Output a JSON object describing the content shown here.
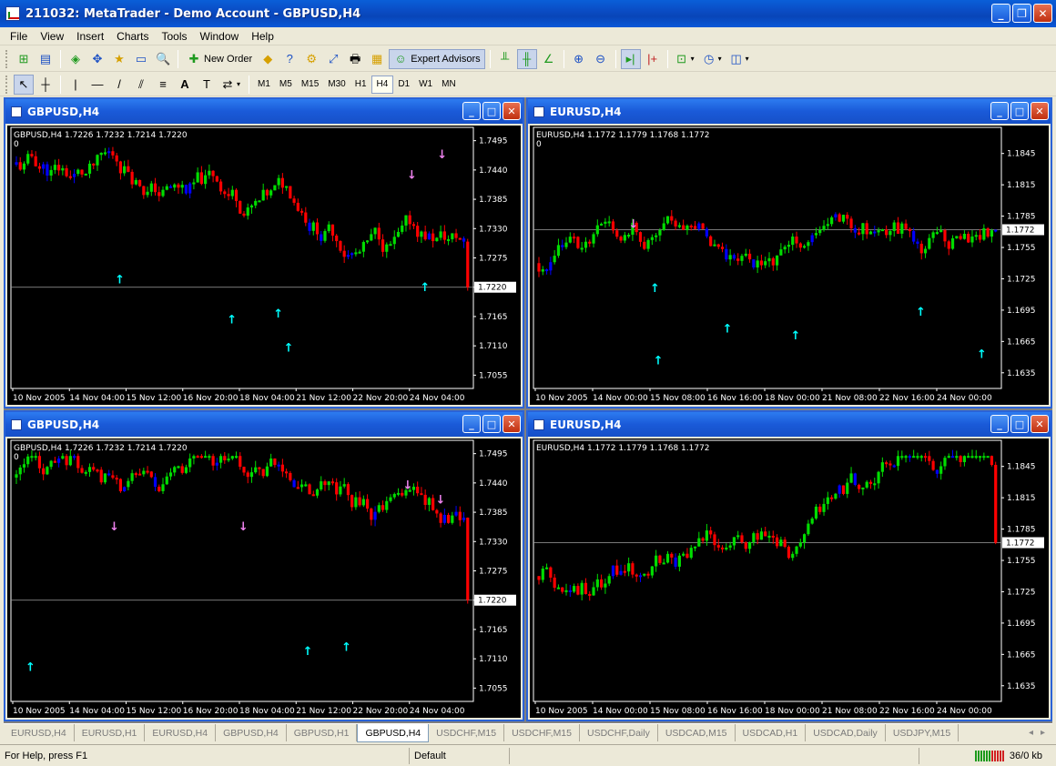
{
  "window": {
    "title": "211032: MetaTrader - Demo Account - GBPUSD,H4",
    "min_glyph": "_",
    "max_glyph": "❐",
    "close_glyph": "✕"
  },
  "menu": [
    "File",
    "View",
    "Insert",
    "Charts",
    "Tools",
    "Window",
    "Help"
  ],
  "toolbar": {
    "new_order_label": "New Order",
    "expert_advisors_label": "Expert Advisors",
    "periods": [
      "M1",
      "M5",
      "M15",
      "M30",
      "H1",
      "H4",
      "D1",
      "W1",
      "MN"
    ],
    "active_period": "H4",
    "glyphs": {
      "new_chart": "⊞",
      "profiles": "▤",
      "market_watch": "◈",
      "navigator": "✥",
      "data_window": "★",
      "terminal": "▭",
      "tester": "🔍",
      "meta_editor": "◆",
      "help": "?",
      "options": "⚙",
      "fullscreen": "⤢",
      "print": "🖶",
      "print_preview": "▦",
      "bar_chart": "╨",
      "candles": "╫",
      "line_chart": "∠",
      "zoom_in": "⊕",
      "zoom_out": "⊖",
      "autoscroll": "▸|",
      "chart_shift": "|+",
      "indicators": "⊡",
      "periods_btn": "◷",
      "templates": "◫",
      "cursor": "↖",
      "crosshair": "┼",
      "vline": "|",
      "hline": "—",
      "trendline": "/",
      "channel": "⫽",
      "fibo": "≡",
      "text": "A",
      "label": "T",
      "arrows": "⇄"
    }
  },
  "charts": [
    {
      "title": "GBPUSD,H4",
      "info": "GBPUSD,H4  1.7226 1.7232 1.7214 1.7220",
      "zero_label": "0",
      "price_labels": [
        "1.7495",
        "1.7440",
        "1.7385",
        "1.7330",
        "1.7275",
        "1.7220",
        "1.7165",
        "1.7110",
        "1.7055"
      ],
      "current_price": "1.7220",
      "time_labels": [
        "10 Nov 2005",
        "14 Nov 04:00",
        "15 Nov 12:00",
        "16 Nov 20:00",
        "18 Nov 04:00",
        "21 Nov 12:00",
        "22 Nov 20:00",
        "24 Nov 04:00"
      ],
      "colors": {
        "up": "#00dd00",
        "down": "#ff0000",
        "neutral": "#0000ff",
        "arrow_up": "#00ffff",
        "arrow_down": "#ee82ee"
      },
      "chart_data": {
        "type": "candlestick",
        "ylim": [
          1.703,
          1.752
        ],
        "current": 1.722,
        "bars": 118,
        "start": 1.745,
        "end": 1.722,
        "seed": 11
      }
    },
    {
      "title": "EURUSD,H4",
      "info": "EURUSD,H4  1.1772 1.1779 1.1768 1.1772",
      "zero_label": "0",
      "price_labels": [
        "1.1845",
        "1.1815",
        "1.1785",
        "1.1755",
        "1.1725",
        "1.1695",
        "1.1665",
        "1.1635"
      ],
      "current_price": "1.1772",
      "time_labels": [
        "10 Nov 2005",
        "14 Nov 00:00",
        "15 Nov 08:00",
        "16 Nov 16:00",
        "18 Nov 00:00",
        "21 Nov 08:00",
        "22 Nov 16:00",
        "24 Nov 00:00"
      ],
      "colors": {
        "up": "#00dd00",
        "down": "#ff0000",
        "neutral": "#0000ff",
        "arrow_up": "#00ffff",
        "arrow_down": "#ee82ee"
      },
      "chart_data": {
        "type": "candlestick",
        "ylim": [
          1.162,
          1.187
        ],
        "current": 1.1772,
        "bars": 118,
        "start": 1.174,
        "end": 1.1772,
        "seed": 23
      }
    },
    {
      "title": "GBPUSD,H4",
      "info": "GBPUSD,H4  1.7226 1.7232 1.7214 1.7220",
      "zero_label": "0",
      "price_labels": [
        "1.7495",
        "1.7440",
        "1.7385",
        "1.7330",
        "1.7275",
        "1.7220",
        "1.7165",
        "1.7110",
        "1.7055"
      ],
      "current_price": "1.7220",
      "time_labels": [
        "10 Nov 2005",
        "14 Nov 04:00",
        "15 Nov 12:00",
        "16 Nov 20:00",
        "18 Nov 04:00",
        "21 Nov 12:00",
        "22 Nov 20:00",
        "24 Nov 04:00"
      ],
      "colors": {
        "up": "#00dd00",
        "down": "#ff0000",
        "neutral": "#0000ff",
        "arrow_up": "#00ffff",
        "arrow_down": "#ee82ee"
      },
      "chart_data": {
        "type": "candlestick",
        "ylim": [
          1.703,
          1.752
        ],
        "current": 1.722,
        "bars": 118,
        "start": 1.745,
        "end": 1.722,
        "seed": 37
      }
    },
    {
      "title": "EURUSD,H4",
      "info": "EURUSD,H4  1.1772 1.1779 1.1768 1.1772",
      "zero_label": "",
      "price_labels": [
        "1.1845",
        "1.1815",
        "1.1785",
        "1.1755",
        "1.1725",
        "1.1695",
        "1.1665",
        "1.1635"
      ],
      "current_price": "1.1772",
      "time_labels": [
        "10 Nov 2005",
        "14 Nov 00:00",
        "15 Nov 08:00",
        "16 Nov 16:00",
        "18 Nov 00:00",
        "21 Nov 08:00",
        "22 Nov 16:00",
        "24 Nov 00:00"
      ],
      "colors": {
        "up": "#00dd00",
        "down": "#ff0000",
        "neutral": "#0000ff",
        "arrow_up": "#00ffff",
        "arrow_down": "#ee82ee"
      },
      "chart_data": {
        "type": "candlestick",
        "ylim": [
          1.162,
          1.187
        ],
        "current": 1.1772,
        "bars": 118,
        "start": 1.174,
        "end": 1.1772,
        "seed": 53,
        "no_arrows": true
      }
    }
  ],
  "tabs": [
    "EURUSD,H4",
    "EURUSD,H1",
    "EURUSD,H4",
    "GBPUSD,H4",
    "GBPUSD,H1",
    "GBPUSD,H4",
    "USDCHF,M15",
    "USDCHF,M15",
    "USDCHF,Daily",
    "USDCAD,M15",
    "USDCAD,H1",
    "USDCAD,Daily",
    "USDJPY,M15"
  ],
  "active_tab": 5,
  "tab_scroll": {
    "left": "◂",
    "right": "▸"
  },
  "status": {
    "help": "For Help, press F1",
    "profile": "Default",
    "traffic": "36/0 kb"
  }
}
